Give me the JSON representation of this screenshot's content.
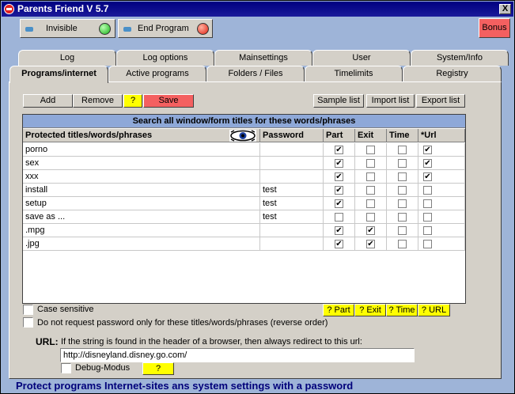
{
  "window": {
    "title": "Parents Friend V 5.7",
    "close_glyph": "X"
  },
  "toolbar": {
    "invisible_label": "Invisible",
    "end_label": "End Program",
    "bonus_label": "Bonus"
  },
  "tabs_row1": [
    "Log",
    "Log options",
    "Mainsettings",
    "User",
    "System/Info"
  ],
  "tabs_row2": [
    "Programs/internet",
    "Active programs",
    "Folders / Files",
    "Timelimits",
    "Registry"
  ],
  "actions": {
    "add": "Add",
    "remove": "Remove",
    "help": "?",
    "save": "Save",
    "sample": "Sample list",
    "import": "Import list",
    "export": "Export list"
  },
  "grid": {
    "title": "Search all window/form titles for these words/phrases",
    "columns": [
      "Protected titles/words/phrases",
      "Password",
      "Part",
      "Exit",
      "Time",
      "*Url"
    ],
    "rows": [
      {
        "title": "porno",
        "password": "",
        "part": true,
        "exit": false,
        "time": false,
        "url": true
      },
      {
        "title": "sex",
        "password": "",
        "part": true,
        "exit": false,
        "time": false,
        "url": true
      },
      {
        "title": "xxx",
        "password": "",
        "part": true,
        "exit": false,
        "time": false,
        "url": true
      },
      {
        "title": "install",
        "password": "test",
        "part": true,
        "exit": false,
        "time": false,
        "url": false
      },
      {
        "title": "setup",
        "password": "test",
        "part": true,
        "exit": false,
        "time": false,
        "url": false
      },
      {
        "title": "save as ...",
        "password": "test",
        "part": false,
        "exit": false,
        "time": false,
        "url": false
      },
      {
        "title": ".mpg",
        "password": "",
        "part": true,
        "exit": true,
        "time": false,
        "url": false
      },
      {
        "title": ".jpg",
        "password": "",
        "part": true,
        "exit": true,
        "time": false,
        "url": false
      }
    ]
  },
  "options": {
    "case_sensitive": "Case sensitive",
    "reverse_order": "Do not request password only for these titles/words/phrases (reverse order)",
    "help_part": "? Part",
    "help_exit": "? Exit",
    "help_time": "? Time",
    "help_url": "? URL"
  },
  "url": {
    "label": "URL:",
    "description": "If the string is found in the header of a browser, then always redirect to this url:",
    "value": "http://disneyland.disney.go.com/",
    "debug_label": "Debug-Modus",
    "debug_help": "?"
  },
  "status": "Protect programs Internet-sites ans system settings with a password"
}
